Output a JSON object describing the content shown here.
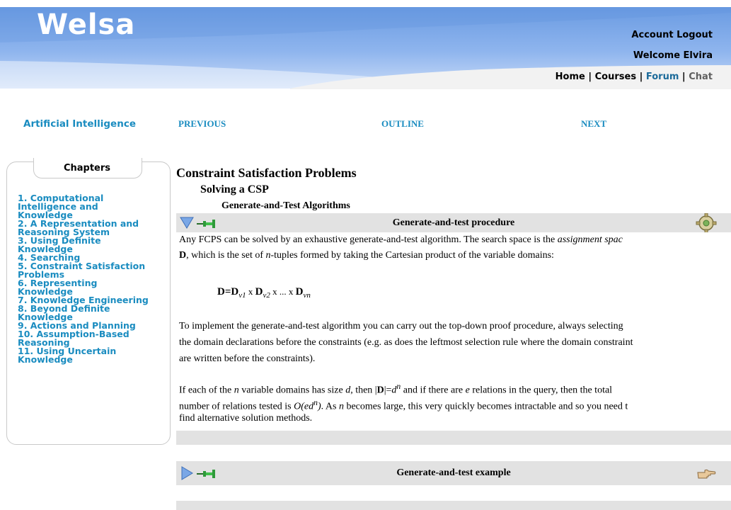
{
  "header": {
    "logo": "Welsa",
    "account_logout": "Account Logout",
    "welcome": "Welcome Elvira",
    "nav": {
      "home": "Home",
      "courses": "Courses",
      "forum": "Forum",
      "chat": "Chat",
      "separator": "|"
    }
  },
  "course": {
    "title": "Artificial Intelligence",
    "previous": "PREVIOUS",
    "outline": "OUTLINE",
    "next": "NEXT"
  },
  "sidebar": {
    "title": "Chapters",
    "items": [
      [
        "1. Computational",
        "Intelligence and",
        "Knowledge"
      ],
      [
        "2. A Representation and",
        "Reasoning System"
      ],
      [
        "3. Using Definite",
        "Knowledge"
      ],
      [
        "4. Searching"
      ],
      [
        "5. Constraint Satisfaction",
        "Problems"
      ],
      [
        "6. Representing",
        "Knowledge"
      ],
      [
        "7. Knowledge Engineering"
      ],
      [
        "8. Beyond Definite",
        "Knowledge"
      ],
      [
        "9. Actions and Planning"
      ],
      [
        "10. Assumption-Based",
        "Reasoning"
      ],
      [
        "11. Using Uncertain",
        "Knowledge"
      ]
    ]
  },
  "main": {
    "heading1": "Constraint Satisfaction Problems",
    "heading2": "Solving a CSP",
    "heading3": "Generate-and-Test Algorithms",
    "panel1": {
      "title": "Generate-and-test procedure",
      "p1_l1_a": "Any FCPS can be solved by an exhaustive generate-and-test algorithm. The search space is the ",
      "p1_l1_em": "assignment spac",
      "p1_l2_bold": "D",
      "p1_l2_a": ", which is the set of ",
      "p1_l2_n": "n",
      "p1_l2_b": "-tuples formed by taking the Cartesian product of the variable domains:",
      "formula": {
        "lhs": "D=D",
        "sub1": "v1",
        "x": " x ",
        "d2": "D",
        "sub2": "v2",
        "dots": " x ... x ",
        "d3": "D",
        "sub3": "vn"
      },
      "p2_l1": "To implement the generate-and-test algorithm you can carry out the top-down proof procedure, always selecting",
      "p2_l2": "the domain declarations before the constraints (e.g. as does the leftmost selection rule where the domain constraint",
      "p2_l3": "are written before the constraints).",
      "p3_l1_a": "If each of the ",
      "p3_l1_n": "n",
      "p3_l1_b": " variable domains has size ",
      "p3_l1_d": "d",
      "p3_l1_c": ", then |",
      "p3_l1_D": "D",
      "p3_l1_e1": "|=",
      "p3_l1_dn": "d",
      "p3_l1_sup": "n",
      "p3_l1_f": " and if there are ",
      "p3_l1_e": "e",
      "p3_l1_g": " relations in the query, then the total",
      "p3_l2_a": "number of relations tested is ",
      "p3_l2_o": "O(ed",
      "p3_l2_sup": "n",
      "p3_l2_close": ")",
      "p3_l2_b": ". As ",
      "p3_l2_n": "n",
      "p3_l2_c": " becomes large, this very quickly becomes intractable and so you need t",
      "p3_l3": "find alternative solution methods."
    },
    "panel2": {
      "title": "Generate-and-test example"
    }
  },
  "icons": {
    "collapse": "triangle-down-icon",
    "expand": "triangle-right-icon",
    "pin": "pin-icon",
    "gear": "gear-icon",
    "hand": "pointing-hand-icon"
  },
  "colors": {
    "link": "#1a8cc0",
    "header_blue": "#6d9ee3",
    "panel_bar": "#e2e2e2"
  }
}
